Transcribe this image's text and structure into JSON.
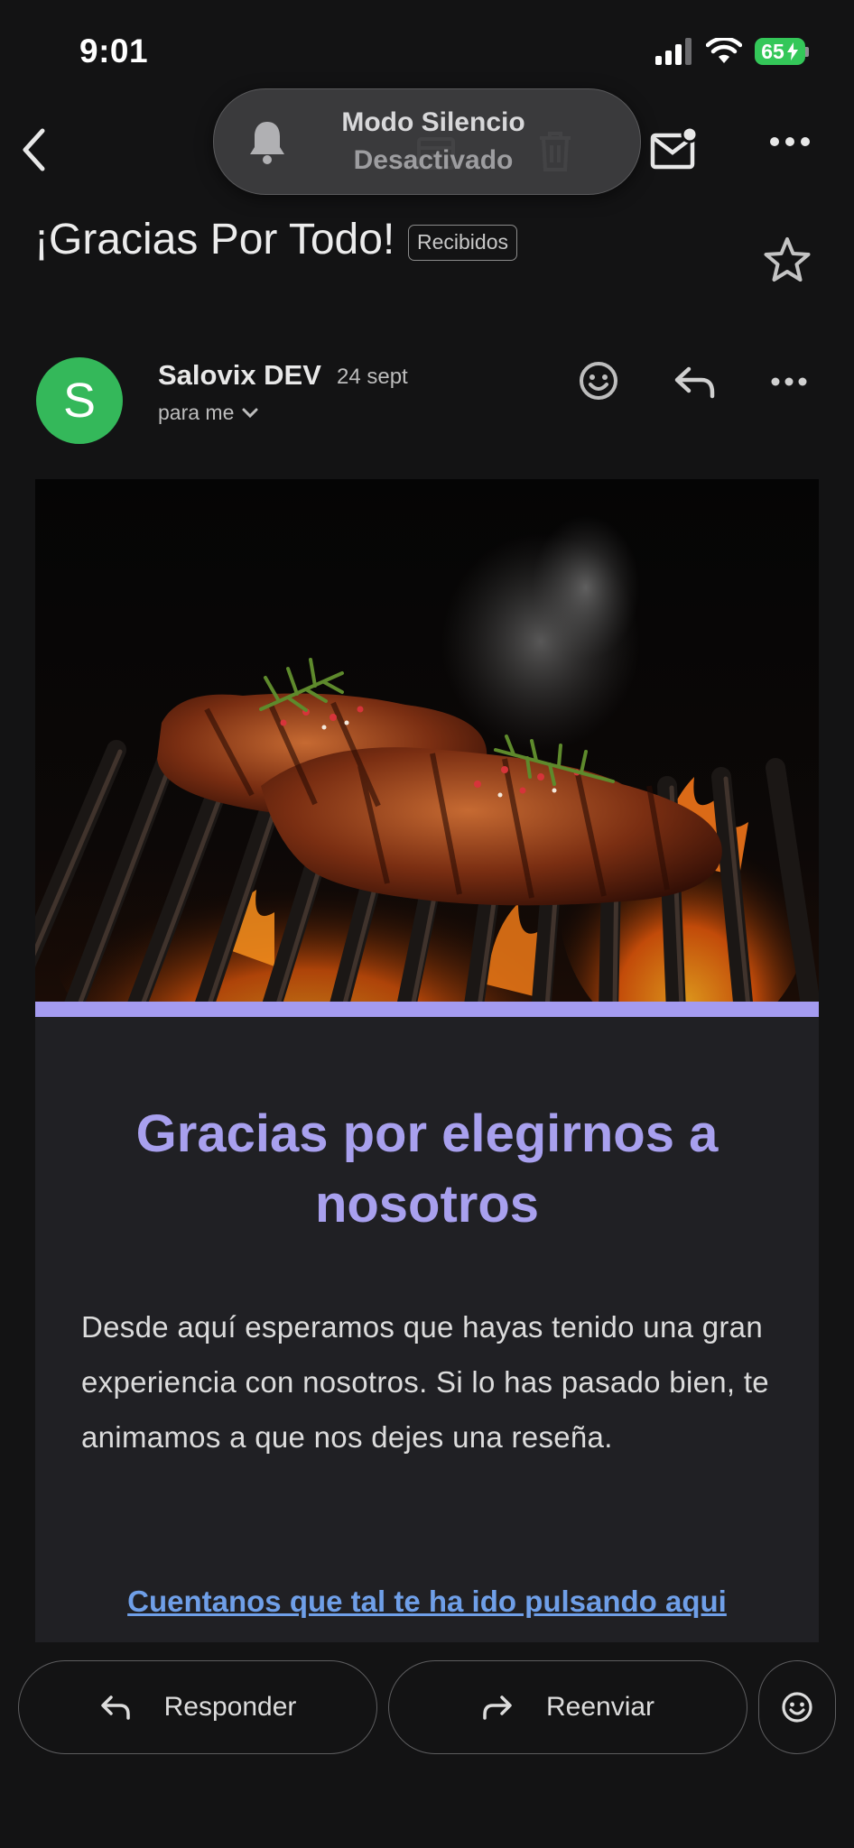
{
  "status_bar": {
    "time": "9:01",
    "battery": "65"
  },
  "toast": {
    "title": "Modo Silencio",
    "subtitle": "Desactivado"
  },
  "email": {
    "subject": "¡Gracias Por Todo!",
    "label": "Recibidos",
    "sender": {
      "initial": "S",
      "name": "Salovix DEV",
      "date": "24 sept",
      "recipients": "para me"
    },
    "body": {
      "headline": "Gracias por elegirnos a nosotros",
      "paragraph": "Desde aquí esperamos que hayas tenido una gran experiencia con nosotros. Si lo has pasado bien, te animamos a que nos dejes una reseña.",
      "link_text": "Cuentanos que tal te ha ido pulsando aqui"
    }
  },
  "actions": {
    "reply_label": "Responder",
    "forward_label": "Reenviar"
  },
  "colors": {
    "accent": "#a49bf0",
    "headline": "#a8a0ee",
    "link": "#6f9fe8",
    "avatar": "#34b85a",
    "battery": "#34c759"
  }
}
